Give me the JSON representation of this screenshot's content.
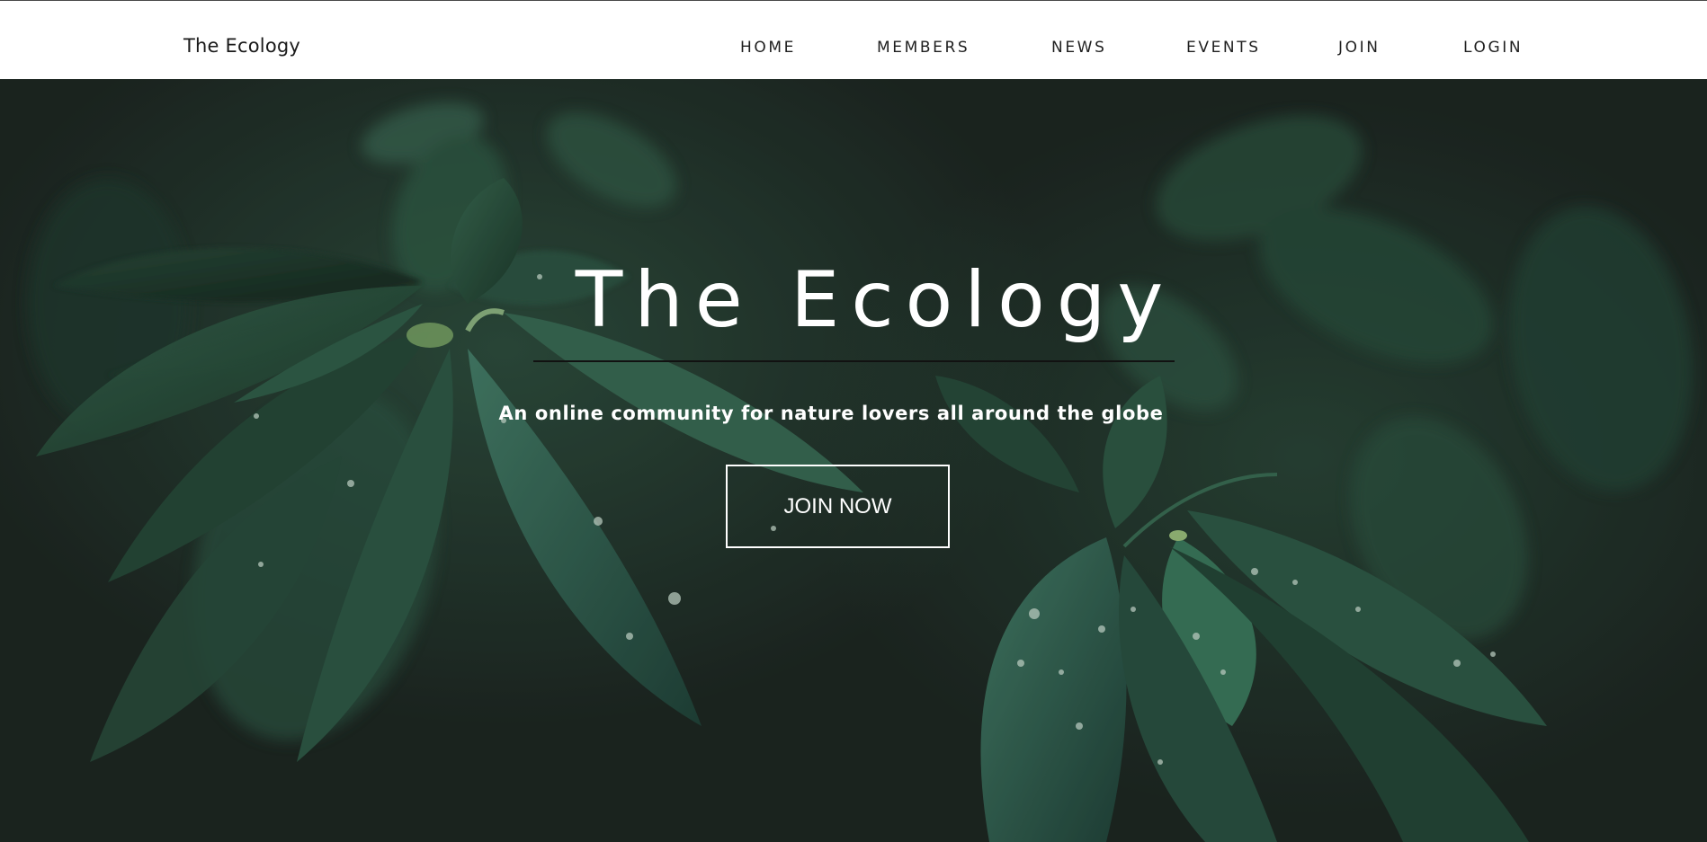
{
  "header": {
    "brand": "The Ecology",
    "nav": {
      "home": "HOME",
      "members": "MEMBERS",
      "news": "NEWS",
      "events": "EVENTS",
      "join": "JOIN",
      "login": "LOGIN"
    }
  },
  "hero": {
    "title": "The Ecology",
    "tagline": "An online community for nature lovers all around the globe",
    "cta_label": "JOIN NOW",
    "background_image": "dark green leaves with water droplets"
  },
  "colors": {
    "header_bg": "#ffffff",
    "nav_text": "#1f1f1f",
    "hero_text": "#ffffff",
    "hero_rule": "#111111",
    "leaf_green": "#2f5a44",
    "dark_bg": "#1c2520"
  }
}
